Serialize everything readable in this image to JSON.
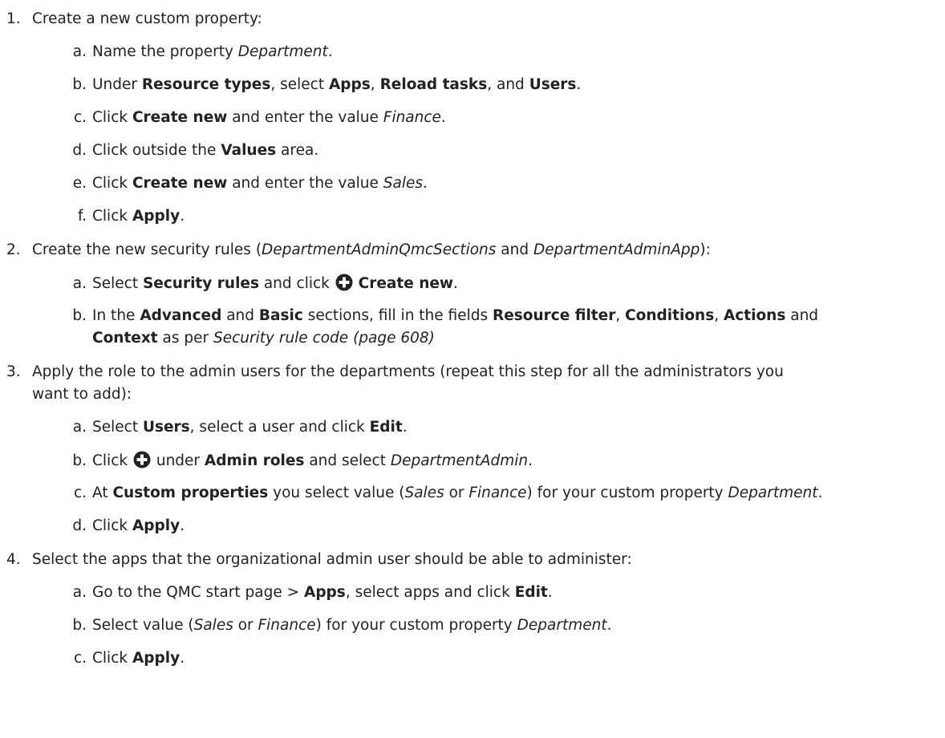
{
  "steps": [
    {
      "num": "1.",
      "text": "Create a new custom property:"
    },
    {
      "num": "a.",
      "pre": "Name the property ",
      "prop": "Department",
      "end": "."
    },
    {
      "num": "b.",
      "pre": "Under ",
      "rt": "Resource types",
      "mid1": ", select ",
      "apps": "Apps",
      "comma": ", ",
      "reload": "Reload tasks",
      "and": ", and ",
      "users": "Users",
      "end": "."
    },
    {
      "num": "c.",
      "pre": "Click ",
      "cn": "Create new",
      "mid": " and enter the value ",
      "val": "Finance",
      "end": "."
    },
    {
      "num": "d.",
      "pre": "Click outside the ",
      "values": "Values",
      "end": " area."
    },
    {
      "num": "e.",
      "pre": "Click ",
      "cn": "Create new",
      "mid": " and enter the value ",
      "val": "Sales",
      "end": "."
    },
    {
      "num": "f.",
      "pre": "Click ",
      "apply": "Apply",
      "end": "."
    },
    {
      "num": "2.",
      "pre": "Create the new security rules (",
      "r1": "DepartmentAdminQmcSections",
      "and": " and ",
      "r2": "DepartmentAdminApp",
      "end": "):"
    },
    {
      "num": "a.",
      "pre": "Select ",
      "sr": "Security rules",
      "mid": " and click ",
      "cn": "Create new",
      "end": "."
    },
    {
      "num": "b.",
      "pre": "In the ",
      "adv": "Advanced",
      "and1": " and ",
      "basic": "Basic",
      "mid": " sections, fill in the fields ",
      "rf": "Resource filter",
      "c1": ", ",
      "cond": "Conditions",
      "c2": ", ",
      "act": "Actions",
      "and2": " and",
      "cont_ctx": "Context",
      "cont_mid": " as per ",
      "cont_link": "Security rule code (page 608)"
    },
    {
      "num": "3.",
      "line1": "Apply the role to the admin users for the departments (repeat this step for all the administrators you",
      "line2": "want to add):"
    },
    {
      "num": "a.",
      "pre": "Select ",
      "users": "Users",
      "mid": ", select a user and click ",
      "edit": "Edit",
      "end": "."
    },
    {
      "num": "b.",
      "pre": "Click ",
      "mid": " under ",
      "ar": "Admin roles",
      "mid2": " and select ",
      "da": "DepartmentAdmin",
      "end": "."
    },
    {
      "num": "c.",
      "pre": "At ",
      "cp": "Custom properties",
      "mid": " you select value (",
      "sales": "Sales",
      "or": " or ",
      "fin": "Finance",
      "mid2": ") for your custom property ",
      "dept": "Department",
      "end": "."
    },
    {
      "num": "d.",
      "pre": "Click ",
      "apply": "Apply",
      "end": "."
    },
    {
      "num": "4.",
      "text": "Select the apps that the organizational admin user should be able to administer:"
    },
    {
      "num": "a.",
      "pre": "Go to the QMC start page > ",
      "apps": "Apps",
      "mid": ", select apps and click ",
      "edit": "Edit",
      "end": "."
    },
    {
      "num": "b.",
      "pre": "Select value (",
      "sales": "Sales",
      "or": " or ",
      "fin": "Finance",
      "mid": ") for your custom property ",
      "dept": "Department",
      "end": "."
    },
    {
      "num": "c.",
      "pre": "Click ",
      "apply": "Apply",
      "end": "."
    }
  ],
  "icons": {
    "plus": "plus-circle-icon"
  }
}
